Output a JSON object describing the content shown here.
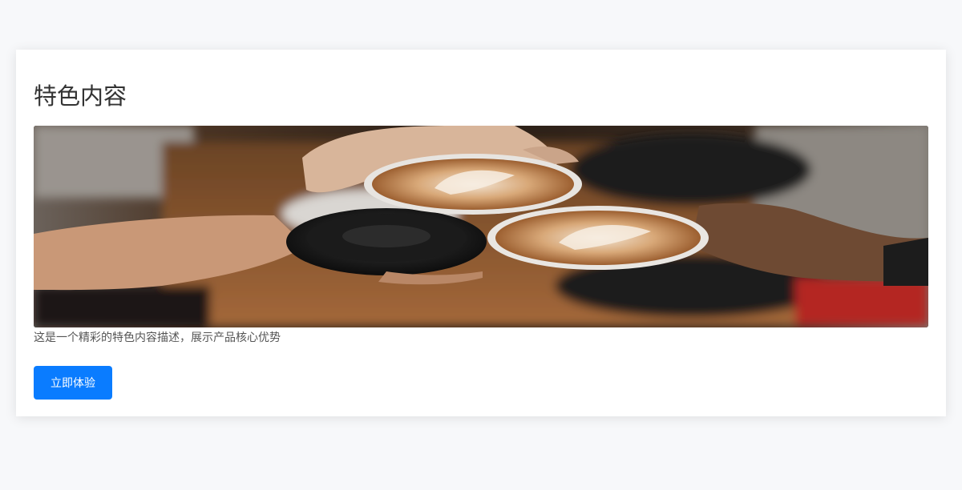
{
  "card": {
    "title": "特色内容",
    "description": "这是一个精彩的特色内容描述，展示产品核心优势",
    "button_label": "立即体验",
    "image_subject": "coffee-cups-cheers-photo"
  },
  "colors": {
    "page_background": "#f7f8fa",
    "card_background": "#ffffff",
    "title_text": "#333333",
    "description_text": "#555555",
    "button_background": "#0a7cff",
    "button_text": "#ffffff"
  }
}
